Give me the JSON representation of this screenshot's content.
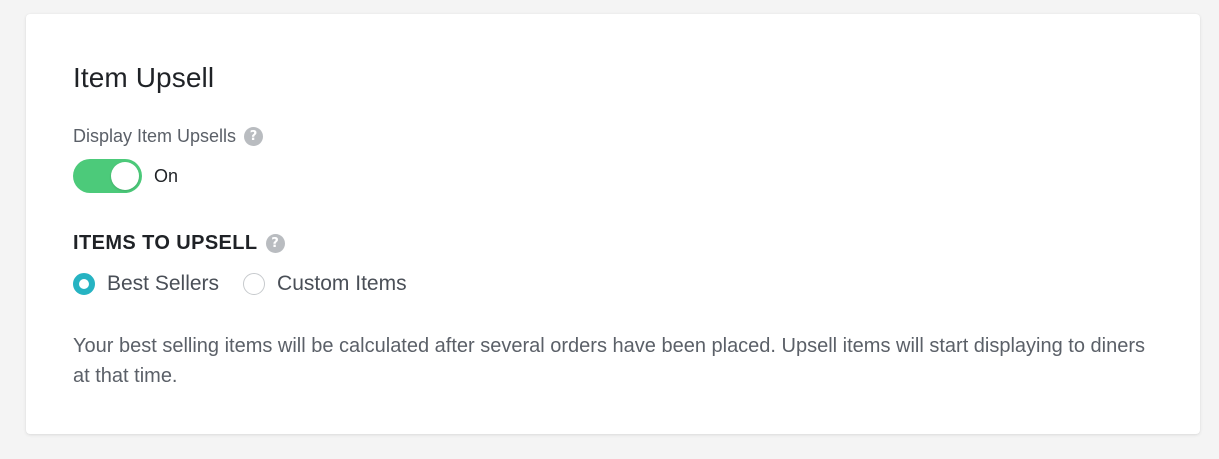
{
  "card": {
    "title": "Item Upsell",
    "display_upsells": {
      "label": "Display Item Upsells",
      "help_icon": "question-circle-icon",
      "toggle_state_label": "On",
      "toggle_on": true,
      "toggle_color": "#4cca7a"
    },
    "items_to_upsell": {
      "heading": "ITEMS TO UPSELL",
      "help_icon": "question-circle-icon",
      "options": [
        {
          "label": "Best Sellers",
          "selected": true
        },
        {
          "label": "Custom Items",
          "selected": false
        }
      ],
      "radio_accent_color": "#26b3c2"
    },
    "description": "Your best selling items will be calculated after several orders have been placed. Upsell items will start displaying to diners at that time."
  }
}
